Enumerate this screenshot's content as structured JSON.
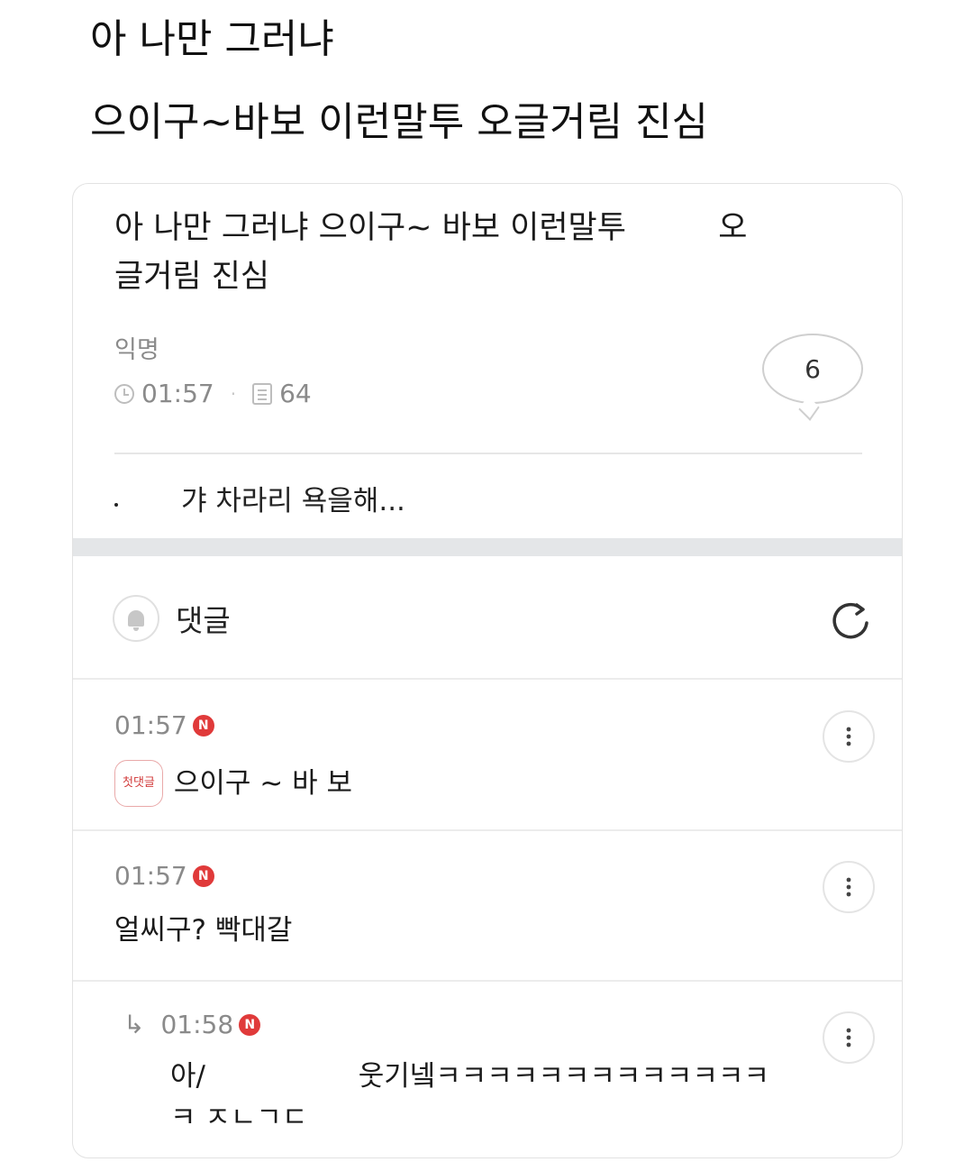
{
  "caption": {
    "line1": "아 나만 그러냐",
    "line2": "으이구~바보 이런말투 오글거림 진심"
  },
  "post": {
    "title_part1": "아 나만 그러냐 으이구~ 바보 이런말투",
    "title_part2": "오",
    "title_line2": "글거림 진심",
    "author": "익명",
    "time": "01:57",
    "views": "64",
    "comment_count": "6",
    "preview_text": "갸 차라리 욕을해..."
  },
  "comments_section": {
    "label": "댓글"
  },
  "comments": [
    {
      "time": "01:57",
      "badge": "N",
      "tag": "첫댓글",
      "text": "으이구 ~ 바 보",
      "is_reply": false
    },
    {
      "time": "01:57",
      "badge": "N",
      "tag": "",
      "text": "얼씨구? 빡대갈",
      "is_reply": false
    },
    {
      "time": "01:58",
      "badge": "N",
      "tag": "",
      "text_part1": "아/",
      "text_part2": "웃기넼ㅋㅋㅋㅋㅋㅋㅋㅋㅋㅋㅋㅋㅋ",
      "text_line2": "ㅋ ㅈㄴㄱㄷ",
      "is_reply": true
    }
  ],
  "colors": {
    "new_badge": "#e03a3a",
    "first_tag": "#d23b3b",
    "band": "#e4e6e8"
  }
}
